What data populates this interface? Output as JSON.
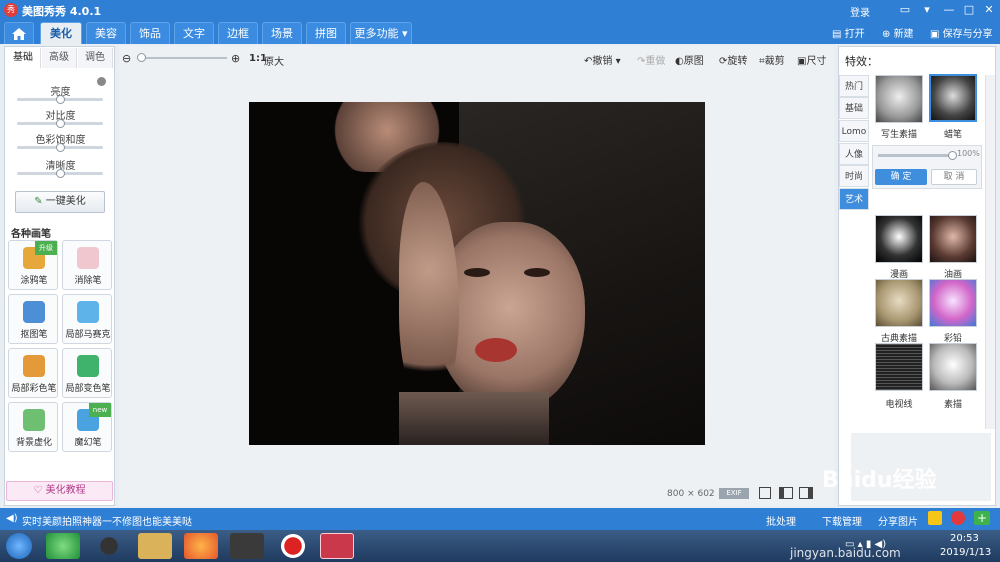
{
  "titlebar": {
    "title": "美图秀秀 4.0.1",
    "login": "登录",
    "min": "—",
    "max": "□",
    "close": "✕"
  },
  "tabs": [
    {
      "label": "美化",
      "active": true
    },
    {
      "label": "美容"
    },
    {
      "label": "饰品"
    },
    {
      "label": "文字"
    },
    {
      "label": "边框"
    },
    {
      "label": "场景"
    },
    {
      "label": "拼图"
    },
    {
      "label": "更多功能 ▾"
    }
  ],
  "toolbar": {
    "open": "打开",
    "new": "新建",
    "save": "保存与分享"
  },
  "left": {
    "subtabs": [
      "基础",
      "高级",
      "调色"
    ],
    "sliders": [
      {
        "label": "亮度",
        "value": 0.5
      },
      {
        "label": "对比度",
        "value": 0.5
      },
      {
        "label": "色彩饱和度",
        "value": 0.5
      },
      {
        "label": "清晰度",
        "value": 0.5
      }
    ],
    "beautify": "一键美化",
    "brush_title": "各种画笔",
    "brushes": [
      {
        "label": "涂鸦笔",
        "ribbon": "升级",
        "color": "#e6a83b"
      },
      {
        "label": "消除笔",
        "ribbon": "",
        "color": "#f1c7cf"
      },
      {
        "label": "抠图笔",
        "ribbon": "",
        "color": "#4d8fd6"
      },
      {
        "label": "局部马赛克",
        "ribbon": "",
        "color": "#5eb4e8"
      },
      {
        "label": "局部彩色笔",
        "ribbon": "",
        "color": "#e59a3a"
      },
      {
        "label": "局部变色笔",
        "ribbon": "",
        "color": "#3fb36b"
      },
      {
        "label": "背景虚化",
        "ribbon": "",
        "color": "#6fbf73"
      },
      {
        "label": "魔幻笔",
        "ribbon": "new",
        "color": "#4aa3e0"
      }
    ],
    "tutorial": "美化教程"
  },
  "canvas": {
    "zoom_label": "原大",
    "ratio": "1:1",
    "undo": "撤销",
    "redo": "重做",
    "original": "原图",
    "rotate": "旋转",
    "crop": "裁剪",
    "size": "尺寸",
    "img_w": "800",
    "img_x": "×",
    "img_h": "602",
    "exif": "EXIF"
  },
  "right": {
    "title": "特效：",
    "categories": [
      "热门",
      "基础",
      "Lomo",
      "人像",
      "时尚",
      "艺术"
    ],
    "active_category": 5,
    "top_effects": [
      "写生素描",
      "蜡笔"
    ],
    "percent": "100%",
    "confirm": "确 定",
    "cancel": "取 消",
    "effects": [
      "漫画",
      "油画",
      "古典素描",
      "彩铅",
      "电视线",
      "素描"
    ]
  },
  "status": {
    "tip": "实时美颜拍照神器一不修图也能美美哒",
    "batch": "批处理",
    "download": "下载管理",
    "share": "分享图片"
  },
  "taskbar": {
    "time": "20:53",
    "date": "2019/1/13"
  },
  "watermark": "Baidu经验",
  "watermark_url": "jingyan.baidu.com"
}
